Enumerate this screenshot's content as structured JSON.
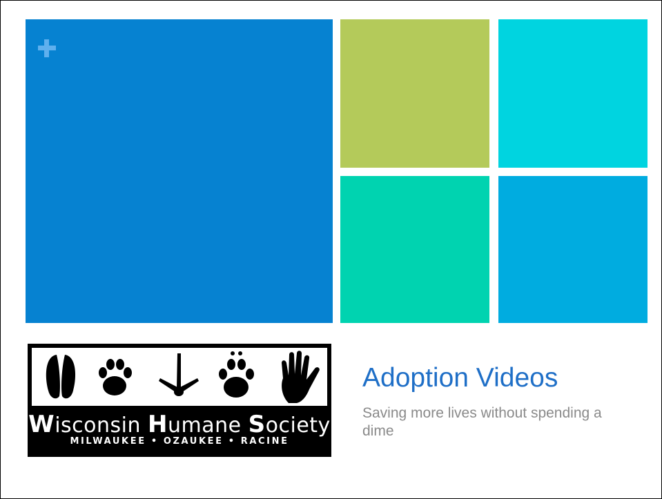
{
  "slide": {
    "title": "Adoption Videos",
    "subtitle": "Saving more lives without spending a dime"
  },
  "logo": {
    "line1_parts": [
      "W",
      "isconsin ",
      "H",
      "umane ",
      "S",
      "ociety"
    ],
    "line2": "MILWAUKEE • OZAUKEE • RACINE"
  },
  "tiles": {
    "colors": [
      "#0682d1",
      "#b4ca5a",
      "#00d4e0",
      "#00d3b0",
      "#00ace0"
    ]
  },
  "icons": [
    "plus-icon",
    "hoof-print-icon",
    "paw-print-icon",
    "bird-track-icon",
    "paw-print-icon",
    "hand-print-icon"
  ]
}
